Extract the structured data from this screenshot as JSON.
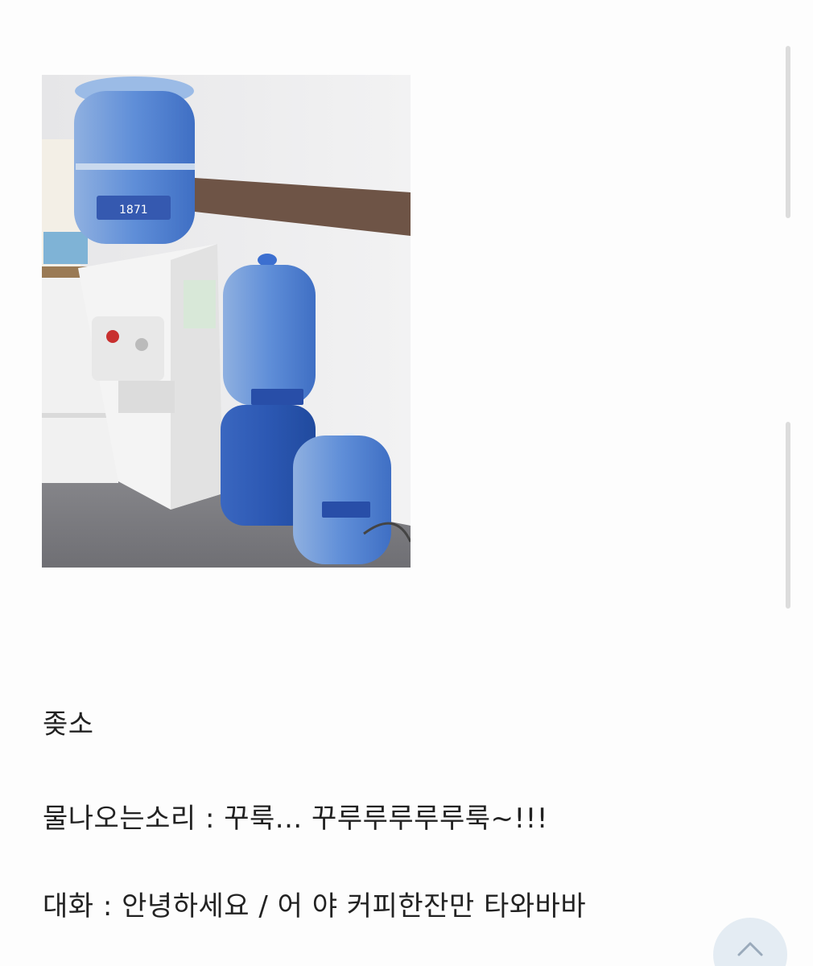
{
  "post": {
    "image": {
      "alt": "water dispenser with water jugs",
      "jug_label": "1871"
    },
    "lines": [
      "좆소",
      "물나오는소리 :  꾸룩... 꾸루루루루루룩~!!!",
      "대화 : 안녕하세요 / 어 야 커피한잔만 타와바바"
    ]
  },
  "colors": {
    "text": "#222222",
    "scrollbar": "#dcdcdc",
    "scroll_top_button": "#e4ecf3"
  },
  "icons": {
    "scroll_top": "chevron-up-icon"
  }
}
